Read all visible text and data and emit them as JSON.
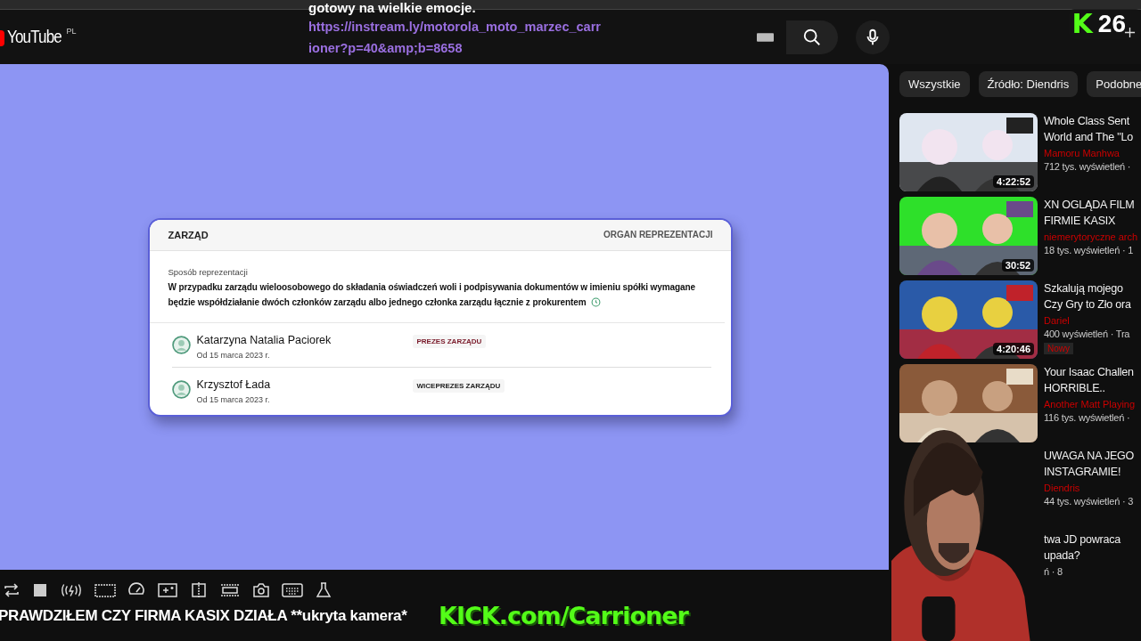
{
  "header": {
    "logo_text": "YouTube",
    "region": "PL"
  },
  "chat_overlay": {
    "message": "gotowy na wielkie emocje.",
    "link_lines": [
      "https://instream.ly/motorola_moto_marzec_carr",
      "ioner?p=40&amp;b=8658"
    ]
  },
  "kick_badge": {
    "logo_letter": "K",
    "count": "26"
  },
  "card": {
    "title": "ZARZĄD",
    "subtitle": "ORGAN REPREZENTACJI",
    "label": "Sposób reprezentacji",
    "text": "W przypadku zarządu wieloosobowego do składania oświadczeń woli i podpisywania dokumentów w imieniu spółki wymagane będzie współdziałanie dwóch członków zarządu albo jednego członka zarządu łącznie z prokurentem",
    "members": [
      {
        "name": "Katarzyna Natalia Paciorek",
        "since": "Od 15 marca 2023 r.",
        "role": "PREZES ZARZĄDU",
        "color": "#7a1a2a"
      },
      {
        "name": "Krzysztof Łada",
        "since": "Od 15 marca 2023 r.",
        "role": "WICEPREZES ZARZĄDU",
        "color": "#222222"
      }
    ]
  },
  "video_title": "PRAWDZIŁEM CZY FIRMA KASIX DZIAŁA **ukryta kamera*",
  "stream_overlay": "KICK.com/Carrioner",
  "chips": [
    {
      "label": "Wszystkie"
    },
    {
      "label": "Źródło: Diendris"
    },
    {
      "label": "Podobne"
    }
  ],
  "videos": [
    {
      "thumb": {
        "kind": "picture",
        "duration": "4:22:52"
      },
      "title_lines": [
        "Whole Class Sent",
        "World and The \"Lo"
      ],
      "channel": "Mamoru Manhwa",
      "meta": "712 tys. wyświetleń ·"
    },
    {
      "thumb": {
        "kind": "picture",
        "duration": "30:52"
      },
      "title_lines": [
        "XN OGLĄDA FILM",
        "FIRMIE KASIX"
      ],
      "channel": "niemerytoryczne arch",
      "meta": "18 tys. wyświetleń · 1"
    },
    {
      "thumb": {
        "kind": "picture",
        "duration": "4:20:46"
      },
      "title_lines": [
        "Szkalują mojego",
        "Czy Gry to Zło ora"
      ],
      "channel": "Dariel",
      "meta": "400 wyświetleń · Tra",
      "badge": "Nowy"
    },
    {
      "thumb": {
        "kind": "picture"
      },
      "title_lines": [
        "Your Isaac Challen",
        "HORRIBLE.."
      ],
      "channel": "Another Matt Playing",
      "meta": "116 tys. wyświetleń ·"
    },
    {
      "title_lines": [
        "UWAGA NA JEGO",
        "INSTAGRAMIE!"
      ],
      "channel": "Diendris",
      "meta": "44 tys. wyświetleń · 3"
    },
    {
      "title_lines": [
        "twa JD powraca",
        "upada?"
      ],
      "meta": "ń · 8"
    }
  ]
}
